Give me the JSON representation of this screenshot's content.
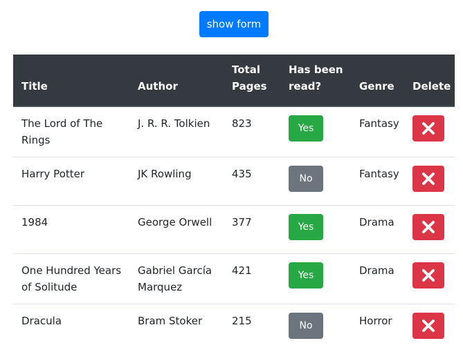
{
  "toolbar": {
    "show_form_label": "show form"
  },
  "table": {
    "headers": {
      "title": "Title",
      "author": "Author",
      "pages": "Total Pages",
      "read": "Has been read?",
      "genre": "Genre",
      "delete": "Delete"
    },
    "rows": [
      {
        "title": "The Lord of The Rings",
        "author": "J. R. R. Tolkien",
        "pages": "823",
        "read": "Yes",
        "genre": "Fantasy"
      },
      {
        "title": "Harry Potter",
        "author": "JK Rowling",
        "pages": "435",
        "read": "No",
        "genre": "Fantasy"
      },
      {
        "title": "1984",
        "author": "George Orwell",
        "pages": "377",
        "read": "Yes",
        "genre": "Drama"
      },
      {
        "title": "One Hundred Years of Solitude",
        "author": "Gabriel García Marquez",
        "pages": "421",
        "read": "Yes",
        "genre": "Drama"
      },
      {
        "title": "Dracula",
        "author": "Bram Stoker",
        "pages": "215",
        "read": "No",
        "genre": "Horror"
      }
    ]
  },
  "icons": {
    "delete": "close-icon"
  },
  "colors": {
    "primary": "#007bff",
    "header_bg": "#343a40",
    "yes": "#28a745",
    "no": "#6c757d",
    "danger": "#dc3545"
  }
}
